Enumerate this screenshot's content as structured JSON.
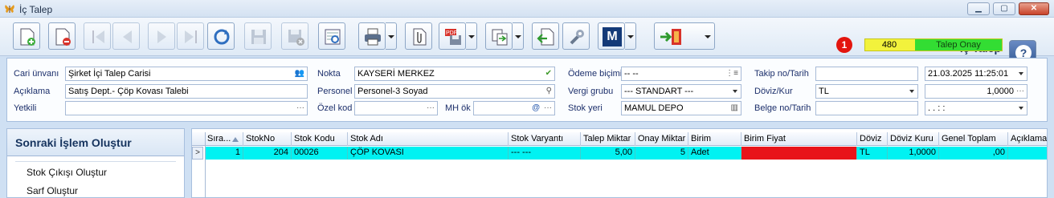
{
  "window": {
    "title": "İç Talep",
    "minimize": "▁",
    "maximize": "▢",
    "close": "✕"
  },
  "toolbar": {
    "form_title": "İç Talep",
    "status_number": "480",
    "status_text": "Talep Onay",
    "badge": "1",
    "help": "?",
    "m_button": "M"
  },
  "form": {
    "cari_label": "Cari ünvanı",
    "cari_value": "Şirket İçi Talep Carisi",
    "aciklama_label": "Açıklama",
    "aciklama_value": "Satış Dept.- Çöp Kovası Talebi",
    "yetkili_label": "Yetkili",
    "yetkili_value": "",
    "nokta_label": "Nokta",
    "nokta_value": "KAYSERİ MERKEZ",
    "personel_label": "Personel",
    "personel_value": "Personel-3 Soyad",
    "ozelkod_label": "Özel kod",
    "ozelkod_value": "",
    "mhok_label": "MH ök",
    "mhok_value": "",
    "odeme_label": "Ödeme biçimi",
    "odeme_value": "-- --",
    "vergi_label": "Vergi grubu",
    "vergi_value": "--- STANDART ---",
    "stokyeri_label": "Stok yeri",
    "stokyeri_value": "MAMUL DEPO",
    "takip_label": "Takip no/Tarih",
    "takip_value": "",
    "tarih_value": "21.03.2025 11:25:01",
    "doviz_label": "Döviz/Kur",
    "doviz_value": "TL",
    "kur_value": "1,0000",
    "belge_label": "Belge no/Tarih",
    "belge_value": "",
    "belge_tarih_value": ". .   : :"
  },
  "left_panel": {
    "header": "Sonraki İşlem Oluştur",
    "items": [
      "Stok Çıkışı Oluştur",
      "Sarf Oluştur"
    ]
  },
  "grid": {
    "columns": [
      "Sıra...",
      "StokNo",
      "Stok Kodu",
      "Stok Adı",
      "Stok Varyantı",
      "Talep Miktar",
      "Onay Miktar",
      "Birim",
      "Birim Fiyat",
      "Döviz",
      "Döviz Kuru",
      "Genel Toplam",
      "Açıklama"
    ],
    "rows": [
      {
        "sira": "1",
        "stokno": "204",
        "stokkodu": "00026",
        "stokadi": "ÇÖP KOVASI",
        "varyant": "--- ---",
        "talep": "5,00",
        "onay": "5",
        "birim": "Adet",
        "fiyat": "",
        "doviz": "TL",
        "kur": "1,0000",
        "toplam": ",00",
        "aciklama": ""
      }
    ]
  },
  "colors": {
    "accent": "#15335e",
    "row_highlight": "#00f2f2",
    "price_cell": "#e8141a",
    "status_yellow": "#f2f23c",
    "status_green": "#33dd33",
    "badge_red": "#e3150e"
  }
}
